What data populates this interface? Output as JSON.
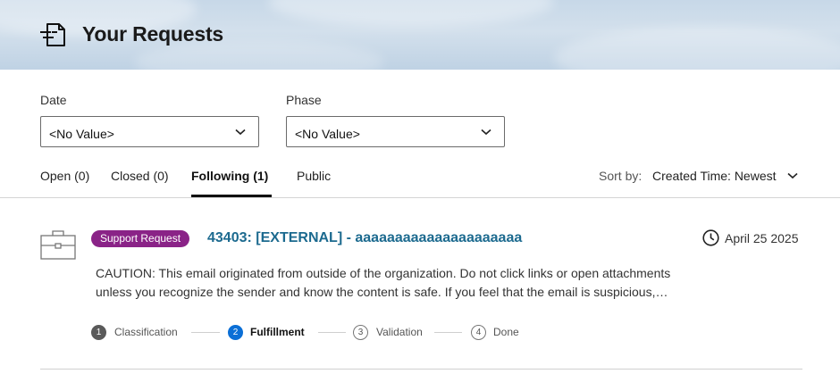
{
  "header": {
    "title": "Your Requests",
    "icon": "request-list-icon"
  },
  "filters": {
    "date": {
      "label": "Date",
      "value": "<No Value>"
    },
    "phase": {
      "label": "Phase",
      "value": "<No Value>"
    }
  },
  "tabs": [
    {
      "label": "Open (0)",
      "active": false
    },
    {
      "label": "Closed (0)",
      "active": false
    },
    {
      "label": "Following (1)",
      "active": true
    },
    {
      "label": "Public",
      "active": false
    }
  ],
  "sort": {
    "label": "Sort by:",
    "value": "Created Time: Newest"
  },
  "request": {
    "icon": "briefcase-icon",
    "badge": "Support Request",
    "title": "43403: [EXTERNAL] - aaaaaaaaaaaaaaaaaaaaa",
    "date": "April 25 2025",
    "description": "CAUTION: This email originated from outside of the organization. Do not click links or open attachments unless you recognize the sender and know the content is safe. If you feel that the email is suspicious, please report it.",
    "steps": [
      {
        "number": "1",
        "label": "Classification",
        "state": "done"
      },
      {
        "number": "2",
        "label": "Fulfillment",
        "state": "current"
      },
      {
        "number": "3",
        "label": "Validation",
        "state": "todo"
      },
      {
        "number": "4",
        "label": "Done",
        "state": "todo"
      }
    ]
  },
  "colors": {
    "badge": "#8a2387",
    "title_link": "#1c6a8f",
    "current_step": "#0b6fd6",
    "done_step": "#5a5a5a"
  }
}
